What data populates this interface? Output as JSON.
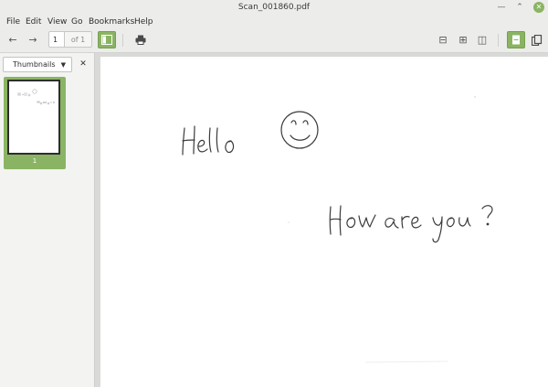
{
  "window": {
    "title": "Scan_001860.pdf",
    "minimize_glyph": "—",
    "maximize_glyph": "⌃",
    "close_glyph": "✕"
  },
  "menu": [
    "File",
    "Edit",
    "View",
    "Go",
    "Bookmarks",
    "Help"
  ],
  "toolbar": {
    "back_glyph": "←",
    "forward_glyph": "→",
    "current_page": "1",
    "page_count": "of 1",
    "print_glyph": "⎙",
    "zoom_out_glyph": "⊟",
    "zoom_in_glyph": "⊞",
    "zoom_fit_glyph": "◫"
  },
  "sidebar": {
    "view_selector": "Thumbnails",
    "dropdown_glyph": "▼",
    "close_glyph": "✕",
    "thumbnails": [
      {
        "page": "1"
      }
    ]
  },
  "icons": {
    "accent": "#8ab463"
  }
}
